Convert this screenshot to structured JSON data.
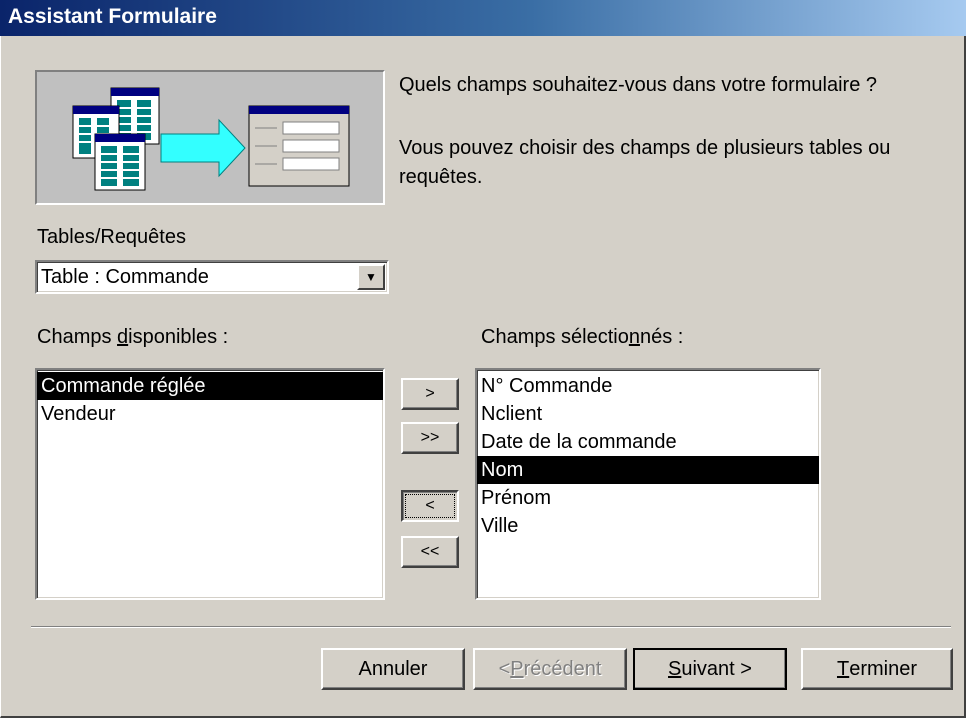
{
  "window": {
    "title": "Assistant Formulaire"
  },
  "intro": {
    "question": "Quels champs souhaitez-vous dans votre formulaire ?",
    "hint": "Vous pouvez choisir des champs de plusieurs tables ou requêtes."
  },
  "source": {
    "label": "Tables/Requêtes",
    "selected": "Table : Commande",
    "arrow_icon": "dropdown-arrow"
  },
  "available": {
    "label_pre": "Champs ",
    "label_mnemonic": "d",
    "label_post": "isponibles :",
    "items": [
      {
        "label": "Commande réglée",
        "selected": true
      },
      {
        "label": "Vendeur",
        "selected": false
      }
    ]
  },
  "selected_fields": {
    "label_pre": "Champs sélectio",
    "label_mnemonic": "n",
    "label_post": "nés :",
    "items": [
      {
        "label": "N° Commande",
        "selected": false
      },
      {
        "label": "Nclient",
        "selected": false
      },
      {
        "label": "Date de la commande",
        "selected": false
      },
      {
        "label": "Nom",
        "selected": true
      },
      {
        "label": "Prénom",
        "selected": false
      },
      {
        "label": "Ville",
        "selected": false
      }
    ]
  },
  "move_buttons": {
    "add_one": ">",
    "add_all": ">>",
    "remove_one": "<",
    "remove_all": "<<"
  },
  "footer": {
    "cancel": "Annuler",
    "prev_mnemonic": "P",
    "prev_pre": "< ",
    "prev_post": "récédent",
    "next_mnemonic": "S",
    "next_post": "uivant >",
    "finish_mnemonic": "T",
    "finish_post": "erminer"
  },
  "colors": {
    "dialog_bg": "#d4d0c8",
    "title_start": "#0a246a",
    "title_end": "#a6caf0",
    "selection_bg": "#000000",
    "selection_fg": "#ffffff"
  }
}
